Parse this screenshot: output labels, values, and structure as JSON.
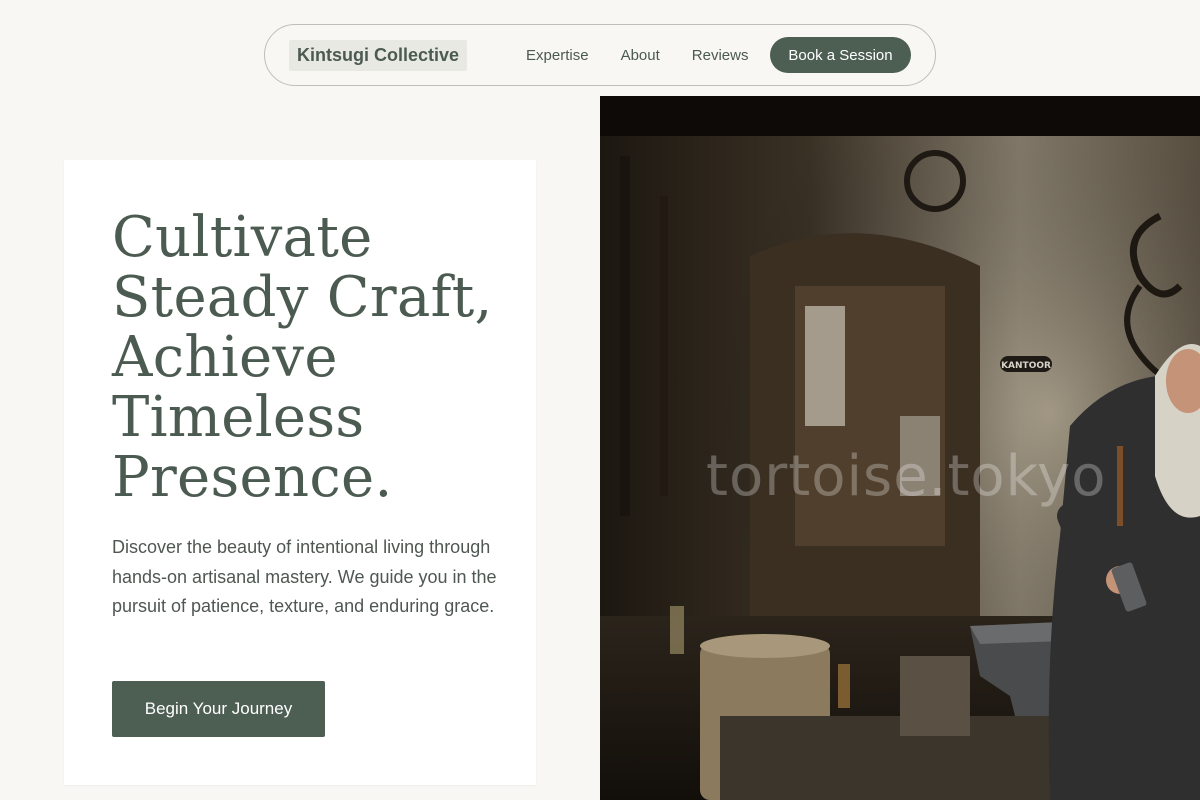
{
  "brand": {
    "name": "Kintsugi Collective"
  },
  "nav": {
    "links": [
      "Expertise",
      "About",
      "Reviews"
    ],
    "cta": "Book a Session"
  },
  "hero": {
    "title_lines": [
      "Cultivate",
      "Steady Craft,",
      "Achieve",
      "Timeless",
      "Presence."
    ],
    "description": "Discover the beauty of intentional living through hands-on artisanal mastery. We guide you in the pursuit of patience, texture, and enduring grace.",
    "cta": "Begin Your Journey"
  },
  "photo": {
    "sign_text": "KANTOOR",
    "watermark": "tortoise.tokyo"
  },
  "colors": {
    "background": "#f8f7f3",
    "accent": "#4d5e53",
    "card": "#ffffff",
    "text": "#4c5b51"
  }
}
